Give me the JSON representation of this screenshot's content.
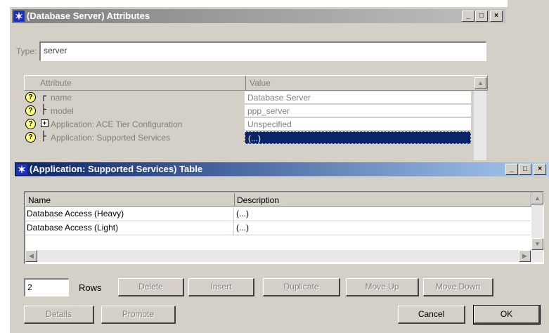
{
  "attributes_window": {
    "title": "(Database Server) Attributes",
    "window_buttons": {
      "minimize": "_",
      "maximize": "□",
      "close": "×"
    },
    "type_label": "Type:",
    "type_value": "server",
    "columns": {
      "attribute": "Attribute",
      "value": "Value"
    },
    "rows": [
      {
        "help": "?",
        "tree": "┌",
        "name": "name",
        "value": "Database Server"
      },
      {
        "help": "?",
        "tree": "├",
        "name": "model",
        "value": "ppp_server"
      },
      {
        "help": "?",
        "tree": "├",
        "expand": "+",
        "name": "Application: ACE Tier Configuration",
        "value": "Unspecified"
      },
      {
        "help": "?",
        "tree": "├",
        "name": "Application: Supported Services",
        "value": "(...)"
      }
    ]
  },
  "table_window": {
    "title": "(Application: Supported Services) Table",
    "window_buttons": {
      "minimize": "_",
      "maximize": "□",
      "close": "×"
    },
    "columns": {
      "name": "Name",
      "description": "Description"
    },
    "rows": [
      {
        "name": "Database Access (Heavy)",
        "description": "(...)"
      },
      {
        "name": "Database Access (Light)",
        "description": "(...)"
      }
    ],
    "rows_value": "2",
    "rows_label": "Rows",
    "buttons": {
      "delete": "Delete",
      "insert": "Insert",
      "duplicate": "Duplicate",
      "move_up": "Move Up",
      "move_down": "Move Down",
      "details": "Details",
      "promote": "Promote",
      "cancel": "Cancel",
      "ok": "OK"
    }
  }
}
